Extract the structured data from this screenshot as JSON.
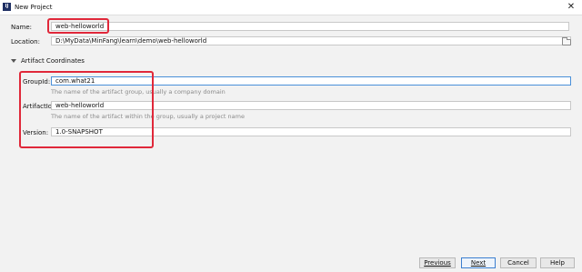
{
  "window": {
    "title": "New Project",
    "app_icon_text": "IJ"
  },
  "name": {
    "label": "Name:",
    "value": "web-helloworld"
  },
  "location": {
    "label": "Location:",
    "value": "D:\\MyData\\MinFang\\learn\\demo\\web-helloworld"
  },
  "artifact": {
    "section_label": "Artifact Coordinates",
    "groupid": {
      "label": "GroupId:",
      "value": "com.what21",
      "hint": "The name of the artifact group, usually a company domain"
    },
    "artifactid": {
      "label": "ArtifactId:",
      "value": "web-helloworld",
      "hint": "The name of the artifact within the group, usually a project name"
    },
    "version": {
      "label": "Version:",
      "value": "1.0-SNAPSHOT"
    }
  },
  "buttons": {
    "previous": "Previous",
    "next": "Next",
    "cancel": "Cancel",
    "help": "Help"
  },
  "colors": {
    "highlight_box": "#e0283a",
    "focus": "#4a90d9"
  }
}
